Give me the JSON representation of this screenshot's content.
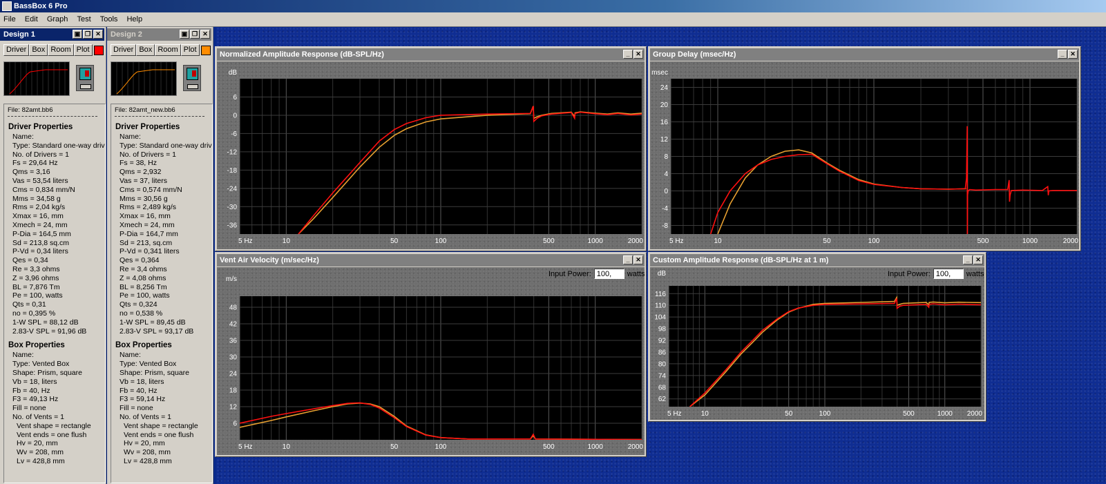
{
  "app": {
    "title": "BassBox 6 Pro"
  },
  "menu": [
    "File",
    "Edit",
    "Graph",
    "Test",
    "Tools",
    "Help"
  ],
  "designs": [
    {
      "title": "Design 1",
      "buttons": [
        "Driver",
        "Box",
        "Room",
        "Plot"
      ],
      "plot_color": "#ff0000",
      "file": "File: 82amt.bb6",
      "driver_heading": "Driver Properties",
      "driver_props": [
        "Name:",
        "Type: Standard one-way drive",
        "No. of Drivers = 1",
        "Fs = 29,64 Hz",
        "Qms = 3,16",
        "Vas = 53,54 liters",
        "Cms = 0,834 mm/N",
        "Mms = 34,58 g",
        "Rms = 2,04 kg/s",
        "Xmax = 16, mm",
        "Xmech = 24, mm",
        "P-Dia = 164,5 mm",
        "Sd = 213,8 sq.cm",
        "P-Vd = 0,34 liters",
        "Qes = 0,34",
        "Re = 3,3 ohms",
        "Z = 3,96 ohms",
        "BL = 7,876 Tm",
        "Pe = 100, watts",
        "Qts = 0,31",
        "no = 0,395 %",
        "1-W SPL = 88,12 dB",
        "2.83-V SPL = 91,96 dB"
      ],
      "box_heading": "Box Properties",
      "box_props": [
        "Name:",
        "Type: Vented Box",
        "Shape: Prism, square",
        "Vb = 18, liters",
        "Fb = 40, Hz",
        "F3 = 49,13 Hz",
        "Fill = none",
        "No. of Vents = 1",
        "Vent shape = rectangle",
        "Vent ends = one flush",
        "Hv = 20, mm",
        "Wv = 208, mm",
        "Lv = 428,8 mm"
      ]
    },
    {
      "title": "Design 2",
      "buttons": [
        "Driver",
        "Box",
        "Room",
        "Plot"
      ],
      "plot_color": "#ff8c00",
      "file": "File: 82amt_new.bb6",
      "driver_heading": "Driver Properties",
      "driver_props": [
        "Name:",
        "Type: Standard one-way drive",
        "No. of Drivers = 1",
        "Fs = 38, Hz",
        "Qms = 2,932",
        "Vas = 37, liters",
        "Cms = 0,574 mm/N",
        "Mms = 30,56 g",
        "Rms = 2,489 kg/s",
        "Xmax = 16, mm",
        "Xmech = 24, mm",
        "P-Dia = 164,7 mm",
        "Sd = 213, sq.cm",
        "P-Vd = 0,341 liters",
        "Qes = 0,364",
        "Re = 3,4 ohms",
        "Z = 4,08 ohms",
        "BL = 8,256 Tm",
        "Pe = 100, watts",
        "Qts = 0,324",
        "no = 0,538 %",
        "1-W SPL = 89,45 dB",
        "2.83-V SPL = 93,17 dB"
      ],
      "box_heading": "Box Properties",
      "box_props": [
        "Name:",
        "Type: Vented Box",
        "Shape: Prism, square",
        "Vb = 18, liters",
        "Fb = 40, Hz",
        "F3 = 59,14 Hz",
        "Fill = none",
        "No. of Vents = 1",
        "Vent shape = rectangle",
        "Vent ends = one flush",
        "Hv = 20, mm",
        "Wv = 208, mm",
        "Lv = 428,8 mm"
      ]
    }
  ],
  "graphs": {
    "amplitude": {
      "title": "Normalized Amplitude Response (dB-SPL/Hz)"
    },
    "group_delay": {
      "title": "Group Delay (msec/Hz)"
    },
    "vent": {
      "title": "Vent Air Velocity (m/sec/Hz)",
      "input_label": "Input Power:",
      "input_value": "100,",
      "input_unit": "watts"
    },
    "custom": {
      "title": "Custom Amplitude Response (dB-SPL/Hz at 1 m)",
      "input_label": "Input Power:",
      "input_value": "100,",
      "input_unit": "watts"
    }
  },
  "chart_data": [
    {
      "id": "amplitude",
      "type": "line",
      "ylabel": "dB",
      "xscale": "log",
      "xlim": [
        5,
        2000
      ],
      "ylim": [
        -39,
        12
      ],
      "yticks": [
        6,
        0,
        -6,
        -12,
        -18,
        -24,
        -30,
        -36
      ],
      "xticks": [
        [
          "5 Hz",
          5
        ],
        [
          "10",
          10
        ],
        [
          "50",
          50
        ],
        [
          "100",
          100
        ],
        [
          "500",
          500
        ],
        [
          "1000",
          1000
        ],
        [
          "2000",
          2000
        ]
      ],
      "grid": true,
      "series": [
        {
          "color": "#e8a030",
          "x": [
            12,
            15,
            20,
            25,
            30,
            40,
            50,
            60,
            80,
            100,
            200,
            380,
            397,
            400,
            420,
            450,
            520,
            700,
            735,
            740,
            800,
            1000,
            1200,
            1400,
            1700,
            2000
          ],
          "y": [
            -39,
            -34,
            -27,
            -21.5,
            -17,
            -10.5,
            -6.6,
            -4.4,
            -2.2,
            -1.2,
            0,
            0.5,
            3,
            -1,
            -0.5,
            0,
            0.6,
            1,
            -0.4,
            0.8,
            1.1,
            0.7,
            0.4,
            0.8,
            0.4,
            0.7
          ]
        },
        {
          "color": "#ff1010",
          "x": [
            12,
            15,
            20,
            25,
            30,
            40,
            50,
            60,
            80,
            100,
            200,
            380,
            397,
            400,
            420,
            450,
            520,
            700,
            735,
            740,
            800,
            1000,
            1200,
            1400,
            1700,
            2000
          ],
          "y": [
            -39,
            -33,
            -25.5,
            -20,
            -15.5,
            -8.5,
            -4.7,
            -2.7,
            -0.8,
            0,
            0.4,
            0.6,
            3,
            -2,
            -1,
            -0.2,
            0.4,
            0.9,
            -1,
            0.6,
            1,
            0.5,
            0.2,
            0.6,
            0.1,
            0.4
          ]
        }
      ]
    },
    {
      "id": "group_delay",
      "type": "line",
      "ylabel": "msec",
      "xscale": "log",
      "xlim": [
        5,
        2000
      ],
      "ylim": [
        -10,
        26
      ],
      "yticks": [
        24,
        20,
        16,
        12,
        8,
        4,
        0,
        -4,
        -8
      ],
      "xticks": [
        [
          "5 Hz",
          5
        ],
        [
          "10",
          10
        ],
        [
          "50",
          50
        ],
        [
          "100",
          100
        ],
        [
          "500",
          500
        ],
        [
          "1000",
          1000
        ],
        [
          "2000",
          2000
        ]
      ],
      "grid": true,
      "series": [
        {
          "color": "#e8a030",
          "x": [
            10,
            12,
            15,
            18,
            22,
            27,
            33,
            40,
            50,
            60,
            80,
            100,
            150,
            200,
            300,
            390
          ],
          "y": [
            -10,
            -3,
            3,
            6,
            8,
            9.2,
            9.5,
            8.8,
            6.5,
            4.8,
            2.6,
            1.6,
            0.8,
            0.5,
            0.4,
            0.5
          ]
        },
        {
          "color": "#ff1010",
          "x": [
            9,
            10,
            12,
            15,
            18,
            22,
            27,
            33,
            40,
            50,
            60,
            80,
            100,
            150,
            200,
            300,
            385,
            392,
            396,
            397,
            398,
            402,
            410,
            450,
            600,
            720,
            735,
            740,
            745,
            760,
            900,
            1200,
            1300,
            1310,
            1320,
            1400,
            1800,
            2000
          ],
          "y": [
            -10,
            -5,
            0,
            4,
            6,
            7.3,
            8,
            8.4,
            8.5,
            6.3,
            4.6,
            2.4,
            1.5,
            0.8,
            0.5,
            0.4,
            0.5,
            3,
            15,
            -10,
            -1,
            0,
            0.3,
            0.2,
            0.3,
            0.3,
            2.5,
            -2.5,
            -1,
            0.1,
            0.2,
            0.1,
            1,
            -1,
            0,
            0.1,
            0.1,
            0.1
          ]
        }
      ]
    },
    {
      "id": "vent",
      "type": "line",
      "ylabel": "m/s",
      "xscale": "log",
      "xlim": [
        5,
        2000
      ],
      "ylim": [
        0,
        52
      ],
      "yticks": [
        48,
        42,
        36,
        30,
        24,
        18,
        12,
        6
      ],
      "xticks": [
        [
          "5 Hz",
          5
        ],
        [
          "10",
          10
        ],
        [
          "50",
          50
        ],
        [
          "100",
          100
        ],
        [
          "500",
          500
        ],
        [
          "1000",
          1000
        ],
        [
          "2000",
          2000
        ]
      ],
      "grid": true,
      "series": [
        {
          "color": "#e8a030",
          "x": [
            5,
            8,
            10,
            15,
            20,
            25,
            30,
            35,
            40,
            50,
            60,
            80,
            100,
            150,
            380,
            397,
            410,
            2000
          ],
          "y": [
            4.5,
            7,
            8.3,
            10.5,
            12,
            13,
            13.3,
            13,
            12,
            8.5,
            5,
            1.8,
            0.8,
            0.3,
            0.3,
            1.5,
            0.3,
            0.1
          ]
        },
        {
          "color": "#ff1010",
          "x": [
            5,
            8,
            10,
            15,
            20,
            25,
            30,
            35,
            40,
            50,
            60,
            80,
            100,
            150,
            380,
            397,
            410,
            2000
          ],
          "y": [
            6,
            8.5,
            9.5,
            11.2,
            12.4,
            13.2,
            13.4,
            12.8,
            11.5,
            8,
            4.8,
            1.7,
            0.8,
            0.3,
            0.3,
            2,
            0.3,
            0.1
          ]
        }
      ]
    },
    {
      "id": "custom",
      "type": "line",
      "ylabel": "dB",
      "xscale": "log",
      "xlim": [
        5,
        2000
      ],
      "ylim": [
        58,
        120
      ],
      "yticks": [
        116,
        110,
        104,
        98,
        92,
        86,
        80,
        74,
        68,
        62
      ],
      "xticks": [
        [
          "5 Hz",
          5
        ],
        [
          "10",
          10
        ],
        [
          "50",
          50
        ],
        [
          "100",
          100
        ],
        [
          "500",
          500
        ],
        [
          "1000",
          1000
        ],
        [
          "2000",
          2000
        ]
      ],
      "grid": true,
      "series": [
        {
          "color": "#e8a030",
          "x": [
            7.5,
            10,
            15,
            20,
            25,
            30,
            40,
            50,
            60,
            80,
            100,
            200,
            380,
            397,
            400,
            420,
            450,
            700,
            735,
            740,
            800,
            1000,
            1300,
            2000
          ],
          "y": [
            58,
            64,
            76,
            85,
            91,
            96,
            102.5,
            106.5,
            108.5,
            110.5,
            111,
            111.5,
            112,
            114,
            110,
            110.5,
            111,
            111.5,
            110.2,
            111.5,
            111.7,
            111.3,
            111.6,
            111.4
          ]
        },
        {
          "color": "#ff1010",
          "x": [
            7.5,
            10,
            15,
            20,
            25,
            30,
            40,
            50,
            60,
            80,
            100,
            200,
            380,
            397,
            400,
            420,
            450,
            700,
            735,
            740,
            800,
            1000,
            1300,
            2000
          ],
          "y": [
            58,
            65,
            77,
            86,
            92,
            97,
            103,
            106.8,
            108.6,
            110,
            110.5,
            110.7,
            111,
            113.5,
            108.5,
            109.5,
            110,
            110.5,
            109,
            110.5,
            110.8,
            110.3,
            110.6,
            110.3
          ]
        }
      ]
    }
  ]
}
